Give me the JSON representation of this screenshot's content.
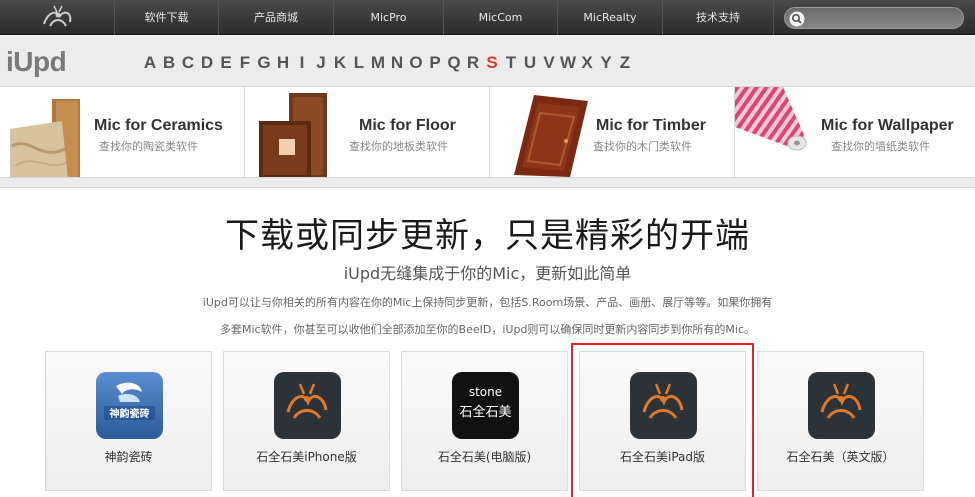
{
  "nav": {
    "items": [
      "软件下载",
      "产品商城",
      "MicPro",
      "MicCom",
      "MicRealty",
      "技术支持"
    ],
    "search_placeholder": ""
  },
  "brand": "iUpd",
  "alphabet": [
    "A",
    "B",
    "C",
    "D",
    "E",
    "F",
    "G",
    "H",
    "I",
    "J",
    "K",
    "L",
    "M",
    "N",
    "O",
    "P",
    "Q",
    "R",
    "S",
    "T",
    "U",
    "V",
    "W",
    "X",
    "Y",
    "Z"
  ],
  "active_letter": "S",
  "categories": [
    {
      "title": "Mic for Ceramics",
      "subtitle": "查找你的陶瓷类软件"
    },
    {
      "title": "Mic for Floor",
      "subtitle": "查找你的地板类软件"
    },
    {
      "title": "Mic for Timber",
      "subtitle": "查找你的木门类软件"
    },
    {
      "title": "Mic for Wallpaper",
      "subtitle": "查找你的墙纸类软件"
    }
  ],
  "main": {
    "headline": "下载或同步更新，只是精彩的开端",
    "subline": "iUpd无缝集成于你的Mic，更新如此简单",
    "para1": "iUpd可以让与你相关的所有内容在你的Mic上保持同步更新，包括S.Room场景、产品、画册、展厅等等。如果你拥有",
    "para2": "多套Mic软件，你甚至可以收他们全部添加至你的BeeID，iUpd则可以确保同时更新内容同步到你所有的Mic。"
  },
  "apps": [
    {
      "name": "神韵瓷砖",
      "icon": "shenyun-tile-icon"
    },
    {
      "name": "石全石美iPhone版",
      "icon": "bee-icon"
    },
    {
      "name": "石全石美(电脑版)",
      "icon": "stone-logo-icon",
      "icon_text": "石全石美",
      "icon_top": "stone"
    },
    {
      "name": "石全石美iPad版",
      "icon": "bee-icon"
    },
    {
      "name": "石全石美（英文版）",
      "icon": "bee-icon"
    }
  ],
  "highlighted_app": 3,
  "colors": {
    "accent": "#e23a2a",
    "bee": "#e07a2a",
    "icon_bg": "#2b3238"
  }
}
